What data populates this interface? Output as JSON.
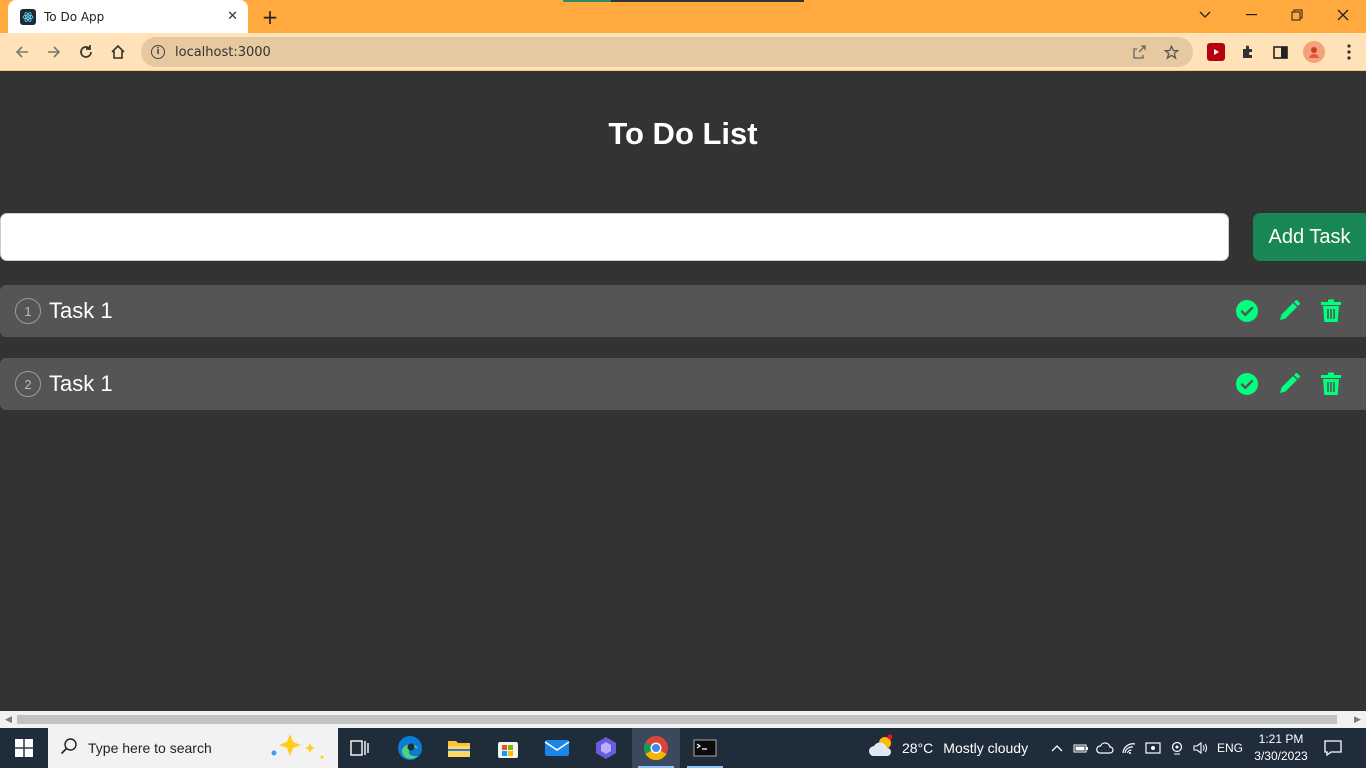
{
  "browser": {
    "tab_title": "To Do App",
    "tab_close": "✕",
    "new_tab": "+",
    "url": "localhost:3000"
  },
  "app": {
    "title": "To Do List",
    "input_value": "",
    "input_placeholder": "",
    "add_button_label": "Add Task",
    "tasks": [
      {
        "number": "1",
        "text": "Task 1"
      },
      {
        "number": "2",
        "text": "Task 1"
      }
    ],
    "accent_color": "#00ff7f",
    "add_button_color": "#198754",
    "background_color": "#333333",
    "row_color": "#555555"
  },
  "taskbar": {
    "search_placeholder": "Type here to search",
    "weather_temp": "28°C",
    "weather_text": "Mostly cloudy",
    "language": "ENG",
    "time": "1:21 PM",
    "date": "3/30/2023"
  }
}
